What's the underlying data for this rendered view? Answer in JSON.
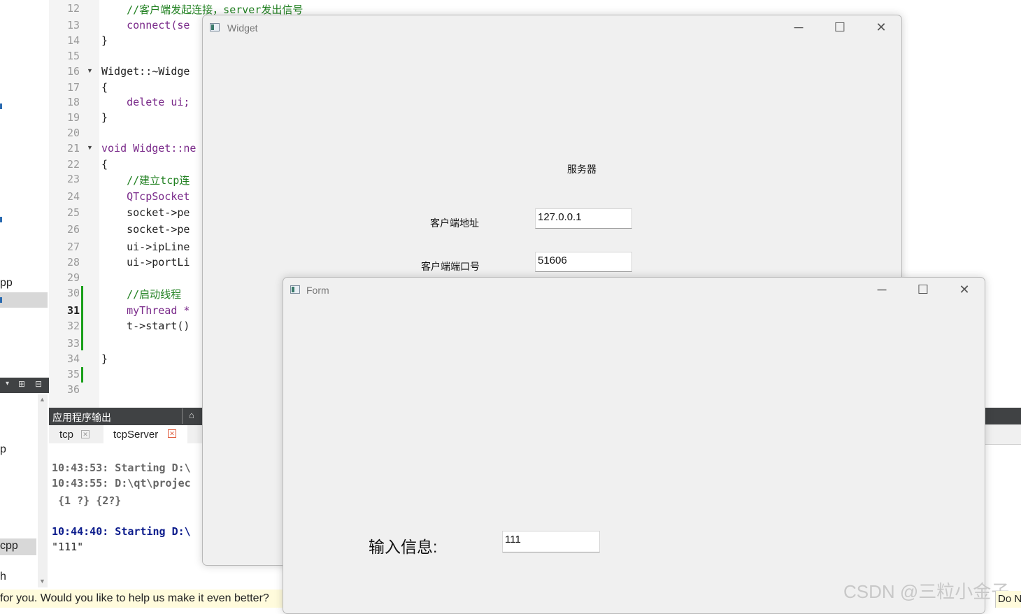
{
  "file_tree": {
    "items": [
      "pp",
      "p",
      "cpp",
      "h"
    ]
  },
  "editor": {
    "line_numbers": [
      "12",
      "13",
      "14",
      "15",
      "16",
      "17",
      "18",
      "19",
      "20",
      "21",
      "22",
      "23",
      "24",
      "25",
      "26",
      "27",
      "28",
      "29",
      "30",
      "31",
      "32",
      "33",
      "34",
      "35",
      "36"
    ],
    "lines": [
      "    //客户端发起连接，server发出信号",
      "    connect(se",
      "}",
      "",
      "Widget::~Widge",
      "{",
      "    delete ui;",
      "}",
      "",
      "void Widget::ne",
      "{",
      "    //建立tcp连",
      "    QTcpSocket",
      "    socket->pe",
      "    socket->pe",
      "    ui->ipLine",
      "    ui->portLi",
      "",
      "    //启动线程",
      "    myThread *",
      "    t->start()",
      "",
      "}",
      "",
      ""
    ]
  },
  "output_pane": {
    "title": "应用程序输出",
    "tabs": [
      {
        "label": "tcp"
      },
      {
        "label": "tcpServer"
      }
    ],
    "lines": [
      "10:43:53: Starting D:\\",
      "10:43:55: D:\\qt\\projec",
      " {1 ?} {2?}",
      "",
      "10:44:40: Starting D:\\",
      "\"111\""
    ]
  },
  "notification": {
    "text": "for you. Would you like to help us make it even better?",
    "button": "Do N"
  },
  "widget_window": {
    "title": "Widget",
    "heading": "服务器",
    "address_label": "客户端地址",
    "address_value": "127.0.0.1",
    "port_label": "客户端端口号",
    "port_value": "51606"
  },
  "form_window": {
    "title": "Form",
    "input_label": "输入信息:",
    "input_value": "111"
  },
  "watermark": "CSDN @三粒小金子"
}
